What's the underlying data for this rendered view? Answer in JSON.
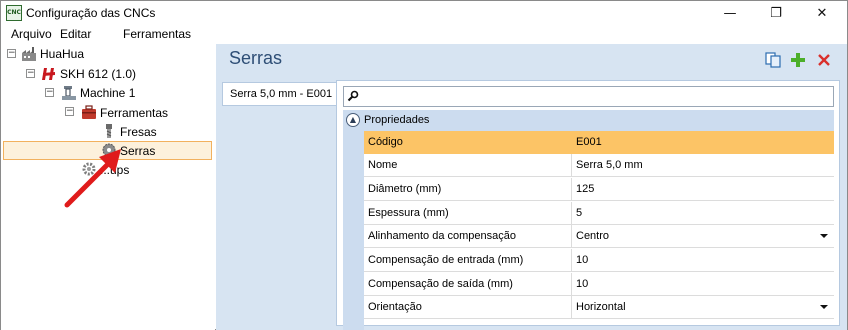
{
  "window": {
    "title": "Configuração das CNCs",
    "icon_text": "CNC",
    "minimize_glyph": "—",
    "maximize_glyph": "❐",
    "close_glyph": "✕"
  },
  "menu": {
    "items": [
      "Arquivo",
      "Editar",
      "Ferramentas"
    ]
  },
  "tree": {
    "root": {
      "label": "HuaHua",
      "icon": "factory-icon",
      "expander": "−"
    },
    "machine_group": {
      "label": "SKH 612 (1.0)",
      "icon": "machine-brand-icon",
      "expander": "−"
    },
    "machine": {
      "label": "Machine 1",
      "icon": "machine-icon",
      "expander": "−"
    },
    "tools": {
      "label": "Ferramentas",
      "icon": "toolbox-icon",
      "expander": "−"
    },
    "fresas": {
      "label": "Fresas",
      "icon": "mill-icon"
    },
    "serras": {
      "label": "Serras",
      "icon": "saw-icon"
    },
    "setups": {
      "label": "...ups",
      "icon": "gear-icon"
    }
  },
  "panel": {
    "title": "Serras",
    "tab_label": "Serra 5,0 mm - E001",
    "search_placeholder": "",
    "group_label": "Propriedades",
    "group_toggle": "▲",
    "properties": [
      {
        "name": "Código",
        "value": "E001",
        "selected": true,
        "dropdown": false
      },
      {
        "name": "Nome",
        "value": "Serra 5,0 mm",
        "selected": false,
        "dropdown": false
      },
      {
        "name": "Diâmetro (mm)",
        "value": "125",
        "selected": false,
        "dropdown": false
      },
      {
        "name": "Espessura (mm)",
        "value": "5",
        "selected": false,
        "dropdown": false
      },
      {
        "name": "Alinhamento da compensação",
        "value": "Centro",
        "selected": false,
        "dropdown": true
      },
      {
        "name": "Compensação de entrada (mm)",
        "value": "10",
        "selected": false,
        "dropdown": false
      },
      {
        "name": "Compensação de saída (mm)",
        "value": "10",
        "selected": false,
        "dropdown": false
      },
      {
        "name": "Orientação",
        "value": "Horizontal",
        "selected": false,
        "dropdown": true
      }
    ]
  },
  "colors": {
    "accent_title": "#2e4e76",
    "selection": "#fcc466",
    "panel_bg": "#d7e4f2",
    "delete_red": "#d9302c",
    "add_green": "#4caf2a",
    "arrow_red": "#e01b1b"
  }
}
